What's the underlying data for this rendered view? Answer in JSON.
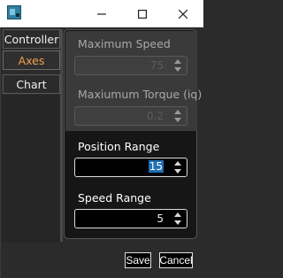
{
  "tabs": [
    {
      "label": "Controller",
      "active": false
    },
    {
      "label": "Axes",
      "active": true
    },
    {
      "label": "Chart",
      "active": false
    }
  ],
  "colors": {
    "active_tab_text": "#f0a050",
    "selection": "#1f6fb5"
  },
  "fields": {
    "max_speed": {
      "label": "Maximum Speed",
      "value": "75",
      "enabled": false
    },
    "max_torque": {
      "label": "Maxiumum Torque (iq)",
      "value": "0.2",
      "enabled": false
    },
    "position_range": {
      "label": "Position Range",
      "value": "15",
      "enabled": true,
      "selected": true
    },
    "speed_range": {
      "label": "Speed Range",
      "value": "5",
      "enabled": true
    }
  },
  "buttons": {
    "save": "Save",
    "cancel": "Cancel"
  },
  "icons": {
    "app": "app-icon",
    "minimize": "minimize-icon",
    "maximize": "maximize-icon",
    "close": "close-icon",
    "spin_up": "arrow-up-icon",
    "spin_down": "arrow-down-icon"
  }
}
